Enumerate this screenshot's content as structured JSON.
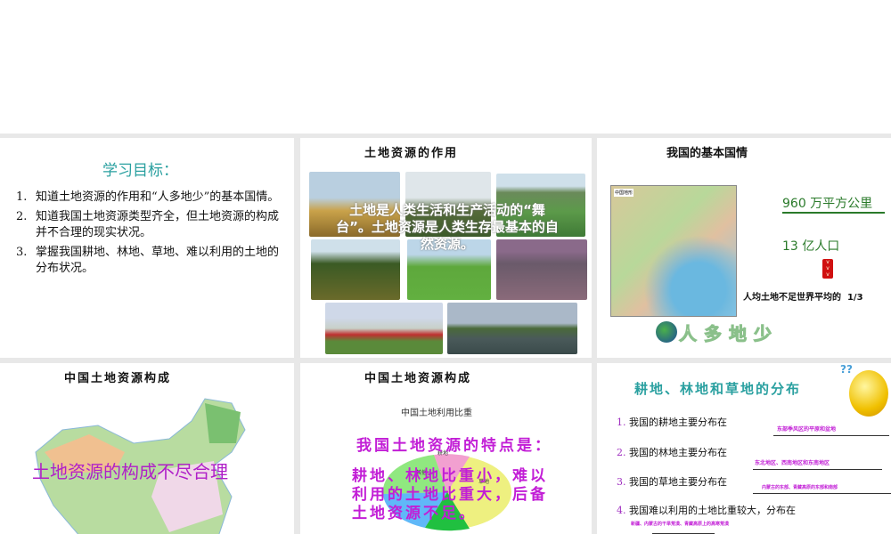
{
  "slides": [
    {
      "title": "学习目标：",
      "items": [
        {
          "num": "1.",
          "text": "知道土地资源的作用和“人多地少”的基本国情。"
        },
        {
          "num": "2.",
          "text": "知道我国土地资源类型齐全，但土地资源的构成并不合理的现实状况。"
        },
        {
          "num": "3.",
          "text": "掌握我国耕地、林地、草地、难以利用的土地的分布状况。"
        }
      ]
    },
    {
      "title": "土地资源的作用",
      "overlay": "土地是人类生活和生产活动的“舞台”。土地资源是人类生存最基本的自然资源。"
    },
    {
      "title": "我国的基本国情",
      "area": "960 万平方公里",
      "population": "13 亿人口",
      "per_capita": "人均土地不足世界平均的  1/3",
      "banner": "人多地少",
      "map_label": "中国地形"
    },
    {
      "title": "中国土地资源构成",
      "overlay": "土地资源的构成不尽合理"
    },
    {
      "title": "中国土地资源构成",
      "chart_title": "中国土地利用比重",
      "pie_labels": [
        "耕地",
        "其他",
        "草地"
      ],
      "heading": "我国土地资源的特点是：",
      "body": "耕地、林地比重小，难以利用的土地比重大，后备土地资源不足。"
    },
    {
      "title": "耕地、林地和草地的分布",
      "items": [
        {
          "num": "1.",
          "text": "我国的耕地主要分布在",
          "answer": "东部季风区的平原和盆地"
        },
        {
          "num": "2.",
          "text": "我国的林地主要分布在",
          "answer": "东北地区、西南地区和东南地区"
        },
        {
          "num": "3.",
          "text": "我国的草地主要分布在",
          "answer": "内蒙古的东部、青藏高原的东部和南部"
        },
        {
          "num": "4.",
          "text": "我国难以利用的土地比重较大，分布在",
          "answer": "新疆、内蒙古的干旱荒漠、青藏高原上的高寒荒漠"
        }
      ]
    }
  ],
  "colors": {
    "teal": "#2aa0a0",
    "magenta": "#c21ed6",
    "green": "#2a7a2a"
  }
}
